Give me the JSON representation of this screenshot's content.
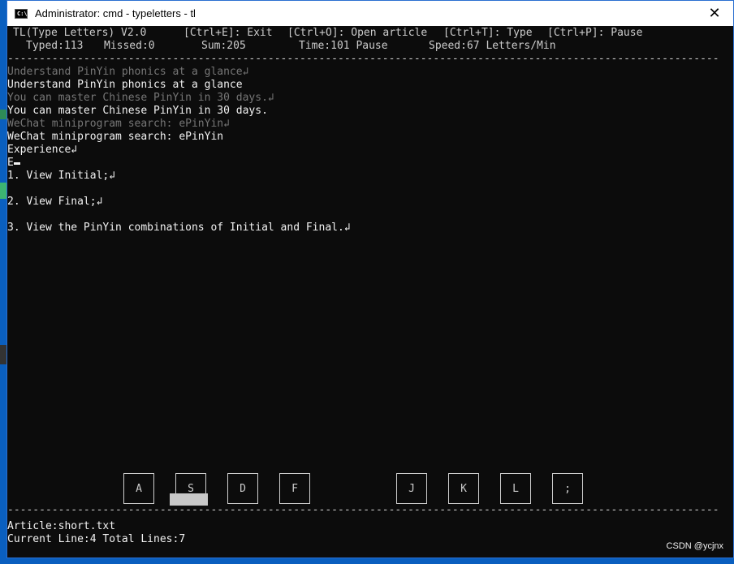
{
  "window": {
    "title": "Administrator: cmd - typeletters - tl",
    "icon_text": "C:\\",
    "close_glyph": "✕"
  },
  "header": {
    "app_name": "TL(Type Letters) V2.0",
    "exit_hint": "[Ctrl+E]: Exit",
    "open_hint": "[Ctrl+O]: Open article",
    "type_hint": "[Ctrl+T]: Type",
    "pause_hint": "[Ctrl+P]: Pause",
    "typed": "Typed:113",
    "missed": "Missed:0",
    "sum": "Sum:205",
    "time": "Time:101 Pause",
    "speed": "Speed:67 Letters/Min",
    "separator": "----------------------------------------------------------------------------------------------------------------"
  },
  "article_lines": [
    {
      "text": "Understand PinYin phonics at a glance↲",
      "style": "dim"
    },
    {
      "text": "Understand PinYin phonics at a glance",
      "style": "bright"
    },
    {
      "text": "You can master Chinese PinYin in 30 days.↲",
      "style": "dim"
    },
    {
      "text": "You can master Chinese PinYin in 30 days.",
      "style": "bright"
    },
    {
      "text": "WeChat miniprogram search: ePinYin↲",
      "style": "dim"
    },
    {
      "text": "WeChat miniprogram search: ePinYin",
      "style": "bright"
    },
    {
      "text": "Experience↲",
      "style": "bright"
    },
    {
      "text": "E",
      "style": "bright"
    },
    {
      "text": "1. View Initial;↲",
      "style": "bright"
    },
    {
      "text": "2. View Final;↲",
      "style": "bright"
    },
    {
      "text": "3. View the PinYin combinations of Initial and Final.↲",
      "style": "bright"
    }
  ],
  "keyboard": {
    "keys": [
      "A",
      "S",
      "D",
      "F",
      "J",
      "K",
      "L",
      ";"
    ],
    "highlighted_key": "S"
  },
  "footer": {
    "separator": "----------------------------------------------------------------------------------------------------------------",
    "article": "Article:short.txt",
    "progress": "Current Line:4 Total Lines:7"
  },
  "watermark": "CSDN @ycjnx",
  "colors": {
    "console_bg": "#0c0c0c",
    "typed_text": "#767676",
    "source_text": "#f2f2f2",
    "desktop": "#0a5fbf"
  }
}
